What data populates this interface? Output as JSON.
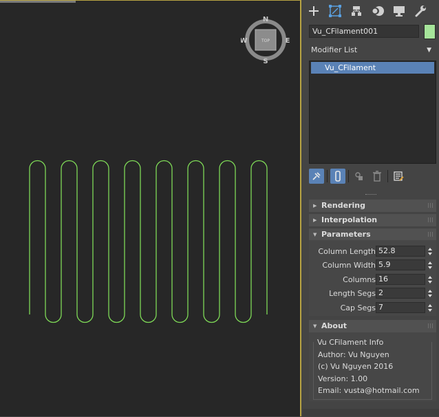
{
  "viewport": {
    "viewcube": {
      "face": "TOP",
      "north": "N",
      "south": "S",
      "east": "E",
      "west": "W"
    },
    "spline_color": "#7ed957"
  },
  "panel": {
    "tabs": [
      {
        "name": "create-tab",
        "icon": "plus-icon"
      },
      {
        "name": "modify-tab",
        "icon": "modify-icon"
      },
      {
        "name": "hierarchy-tab",
        "icon": "hierarchy-icon"
      },
      {
        "name": "motion-tab",
        "icon": "motion-icon"
      },
      {
        "name": "display-tab",
        "icon": "display-icon"
      },
      {
        "name": "utilities-tab",
        "icon": "wrench-icon"
      }
    ],
    "object_name": "Vu_CFilament001",
    "object_color": "#a6e49a",
    "modifier_list_label": "Modifier List",
    "stack_items": [
      "Vu_CFilament"
    ],
    "rollouts": {
      "rendering": "Rendering",
      "interpolation": "Interpolation",
      "parameters": "Parameters",
      "about": "About"
    },
    "parameters": [
      {
        "label": "Column Length",
        "value": "52.8"
      },
      {
        "label": "Column Width",
        "value": "5.9"
      },
      {
        "label": "Columns",
        "value": "16"
      },
      {
        "label": "Length Segs",
        "value": "2"
      },
      {
        "label": "Cap Segs",
        "value": "7"
      }
    ],
    "about": {
      "group_title": "Vu CFilament Info",
      "author": "Author: Vu Nguyen",
      "copyright": "(c) Vu Nguyen 2016",
      "version": "Version: 1.00",
      "email": "Email: vusta@hotmail.com"
    }
  }
}
